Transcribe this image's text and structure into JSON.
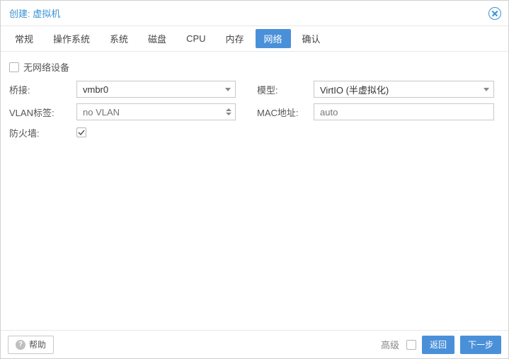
{
  "header": {
    "title": "创建: 虚拟机"
  },
  "tabs": [
    {
      "label": "常规"
    },
    {
      "label": "操作系统"
    },
    {
      "label": "系统"
    },
    {
      "label": "磁盘"
    },
    {
      "label": "CPU"
    },
    {
      "label": "内存"
    },
    {
      "label": "网络",
      "active": true
    },
    {
      "label": "确认"
    }
  ],
  "form": {
    "no_net_label": "无网络设备",
    "bridge_label": "桥接:",
    "bridge_value": "vmbr0",
    "vlan_label": "VLAN标签:",
    "vlan_placeholder": "no VLAN",
    "firewall_label": "防火墙:",
    "model_label": "模型:",
    "model_value": "VirtIO (半虚拟化)",
    "mac_label": "MAC地址:",
    "mac_placeholder": "auto"
  },
  "footer": {
    "help": "帮助",
    "advanced": "高级",
    "back": "返回",
    "next": "下一步"
  }
}
